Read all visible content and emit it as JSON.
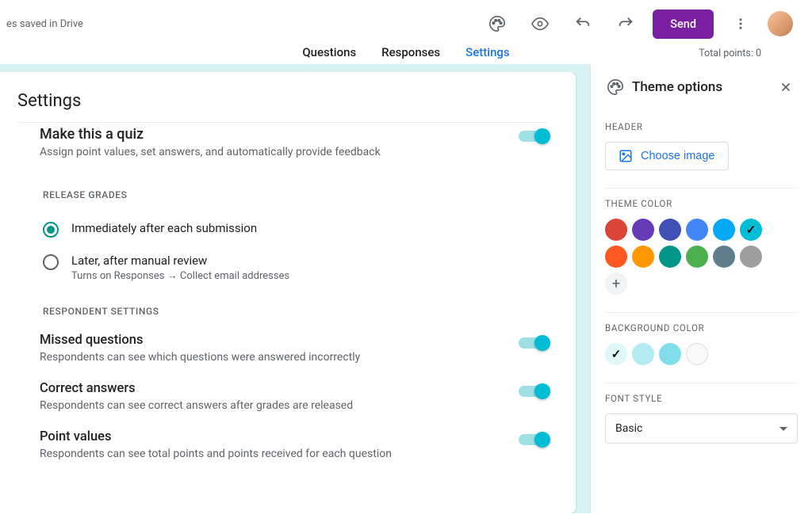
{
  "header": {
    "save_status": "es saved in Drive",
    "send_label": "Send"
  },
  "tabs": {
    "questions": "Questions",
    "responses": "Responses",
    "settings": "Settings"
  },
  "points": "Total points: 0",
  "settings_card": {
    "title": "Settings",
    "quiz": {
      "title": "Make this a quiz",
      "desc": "Assign point values, set answers, and automatically provide feedback"
    },
    "release_section": "RELEASE GRADES",
    "release_opt1": "Immediately after each submission",
    "release_opt2": "Later, after manual review",
    "release_opt2_sub": "Turns on Responses → Collect email addresses",
    "respondent_section": "RESPONDENT SETTINGS",
    "missed": {
      "t": "Missed questions",
      "d": "Respondents can see which questions were answered incorrectly"
    },
    "correct": {
      "t": "Correct answers",
      "d": "Respondents can see correct answers after grades are released"
    },
    "points_row": {
      "t": "Point values",
      "d": "Respondents can see total points and points received for each question"
    }
  },
  "theme": {
    "title": "Theme options",
    "header_label": "HEADER",
    "choose_image": "Choose image",
    "theme_color_label": "THEME COLOR",
    "bg_color_label": "BACKGROUND COLOR",
    "font_label": "FONT STYLE",
    "font_value": "Basic",
    "theme_colors": [
      "#db4437",
      "#673ab7",
      "#3f51b5",
      "#4285f4",
      "#03a9f4",
      "#00bcd4",
      "#ff5722",
      "#ff9800",
      "#009688",
      "#4caf50",
      "#607d8b",
      "#9e9e9e"
    ],
    "bg_colors": [
      "#e0f7fa",
      "#b2ebf2",
      "#80deea",
      "#f8f9fa"
    ],
    "theme_selected_index": 5,
    "bg_selected_index": 0
  }
}
